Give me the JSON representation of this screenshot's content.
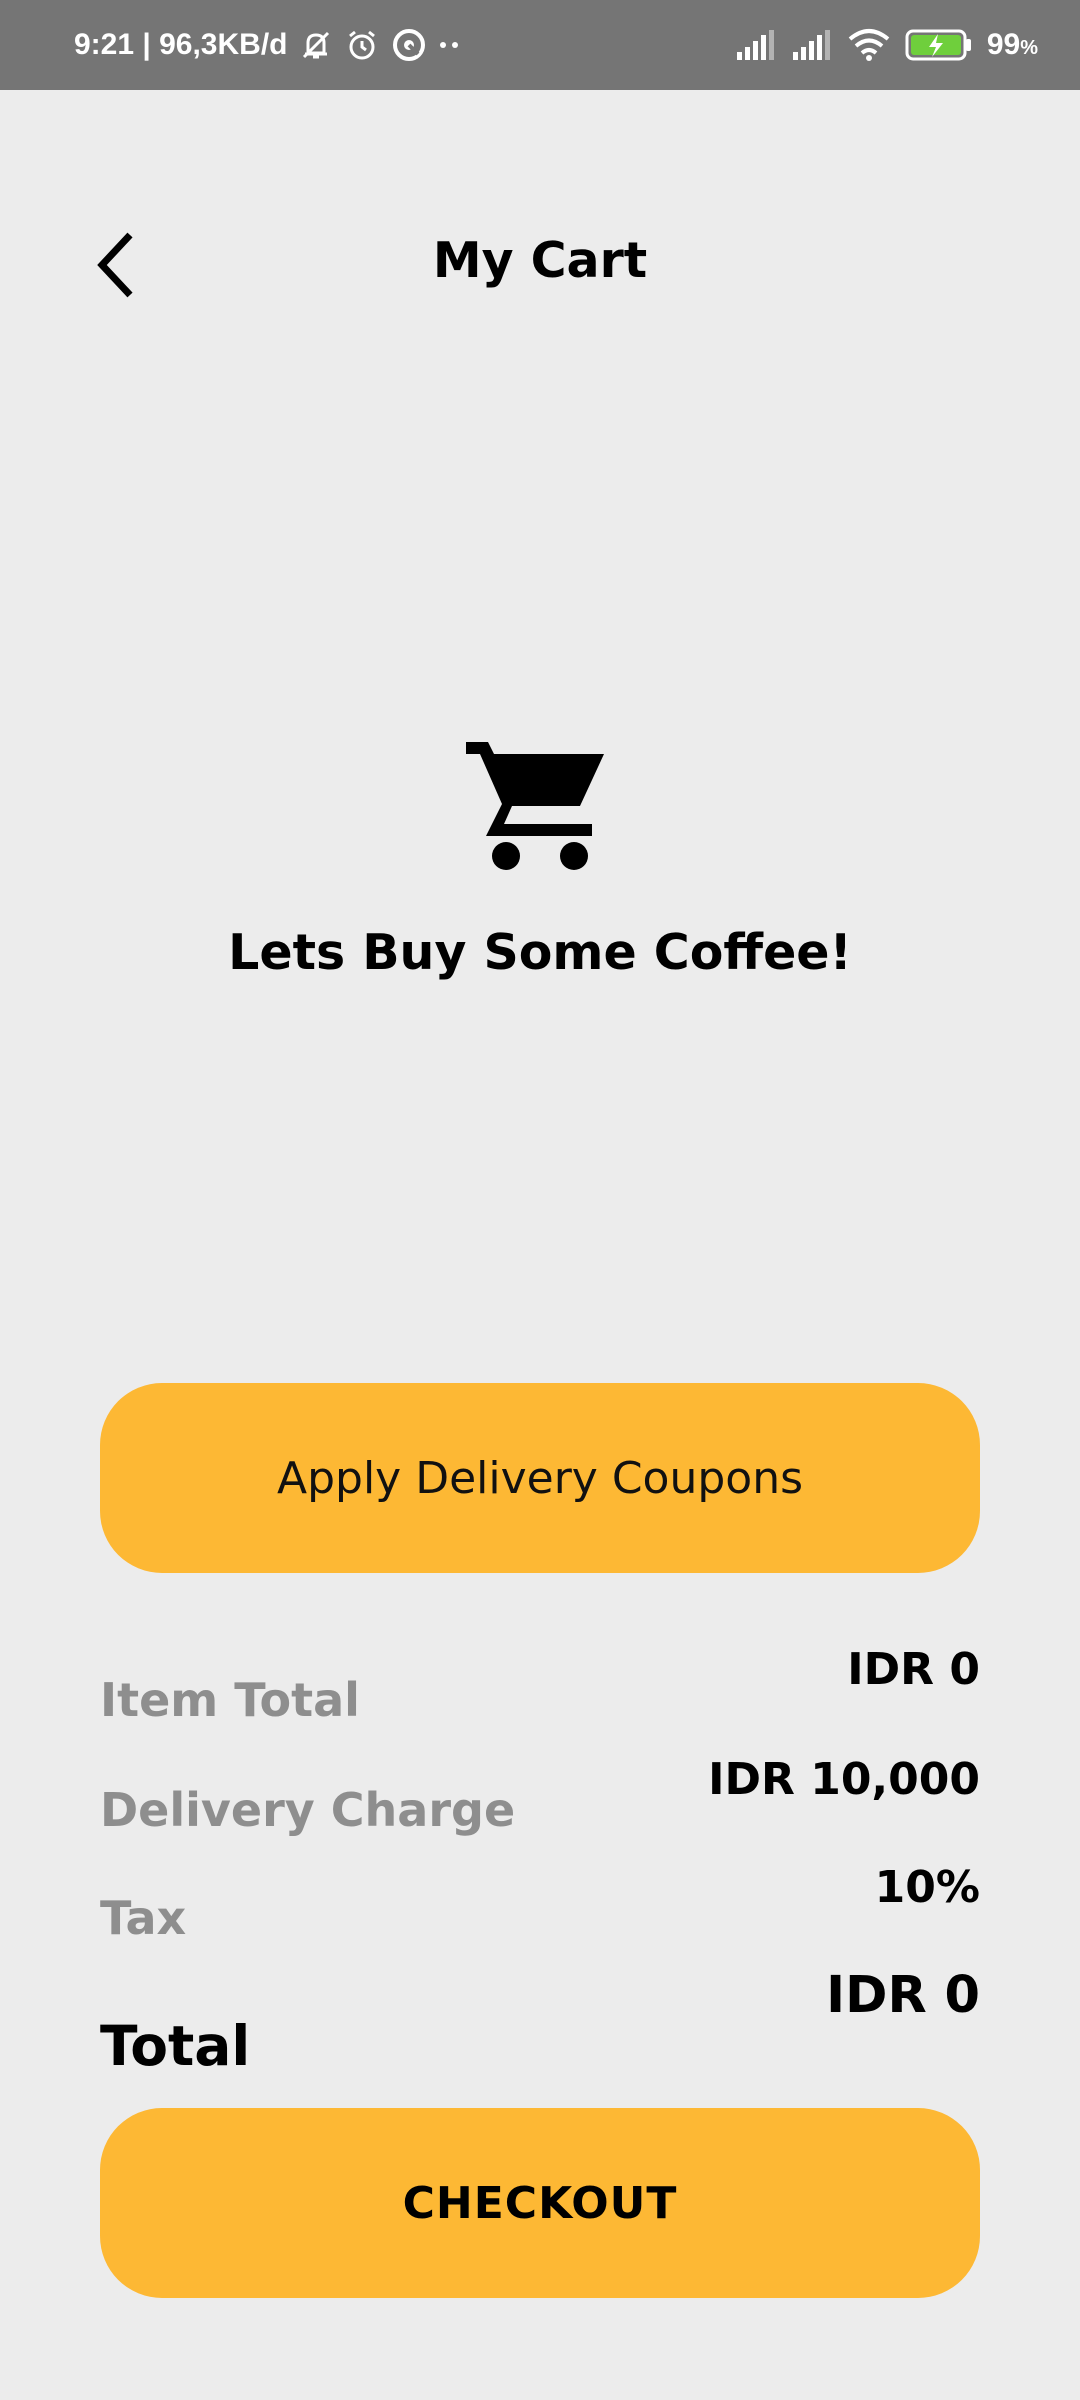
{
  "status_bar": {
    "time_and_speed": "9:21 | 96,3KB/d",
    "battery_percent": "99",
    "battery_unit": "%",
    "icons_left": [
      "mute-icon",
      "alarm-icon",
      "sync-icon",
      "more-dots-icon"
    ],
    "icons_right": [
      "signal-icon",
      "signal-icon",
      "wifi-icon",
      "battery-charging-icon"
    ]
  },
  "header": {
    "title": "My Cart",
    "back_icon": "chevron-left-icon"
  },
  "empty_state": {
    "icon": "shopping-cart-icon",
    "message": "Lets Buy Some Coffee!"
  },
  "coupon": {
    "label": "Apply Delivery Coupons"
  },
  "summary": {
    "item_total_label": "Item Total",
    "item_total_value": "IDR 0",
    "delivery_label": "Delivery Charge",
    "delivery_value": "IDR 10,000",
    "tax_label": "Tax",
    "tax_value": "10%",
    "total_label": "Total",
    "total_value": "IDR 0"
  },
  "checkout": {
    "label": "CHECKOUT"
  },
  "colors": {
    "background": "#ececec",
    "status_bar": "#757575",
    "accent": "#fdb834",
    "muted_text": "#8e8e8e",
    "battery_fill": "#6fcf3c"
  }
}
